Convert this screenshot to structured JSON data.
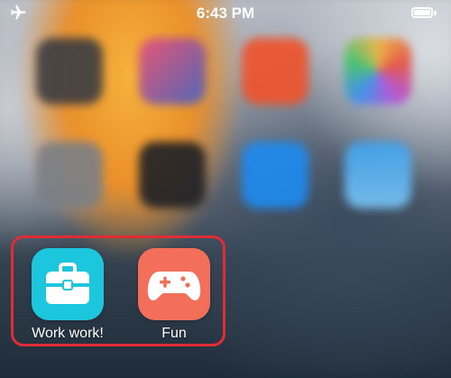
{
  "status_bar": {
    "time": "6:43 PM",
    "left_icon": "airplane-icon",
    "right_icon": "battery-icon"
  },
  "background_apps": [
    {
      "icon": "camera-icon",
      "color": "#3b3d42"
    },
    {
      "icon": "feedback-icon",
      "color": "#3e63c8"
    },
    {
      "icon": "brave-browser-icon",
      "color": "#f0522a"
    },
    {
      "icon": "photos-icon",
      "color": "#f0b33c"
    },
    {
      "icon": "settings-icon",
      "color": "#7b7f86"
    },
    {
      "icon": "magnifier-icon",
      "color": "#1e2026"
    },
    {
      "icon": "app-store-icon",
      "color": "#1d8bf2"
    },
    {
      "icon": "weather-icon",
      "color": "#3ea3f0"
    }
  ],
  "dock_apps": [
    {
      "label": "Work work!",
      "icon": "briefcase-icon",
      "color": "#1cc7dd"
    },
    {
      "label": "Fun",
      "icon": "game-controller-icon",
      "color": "#f36f5a"
    }
  ],
  "highlight_color": "#e12b35"
}
